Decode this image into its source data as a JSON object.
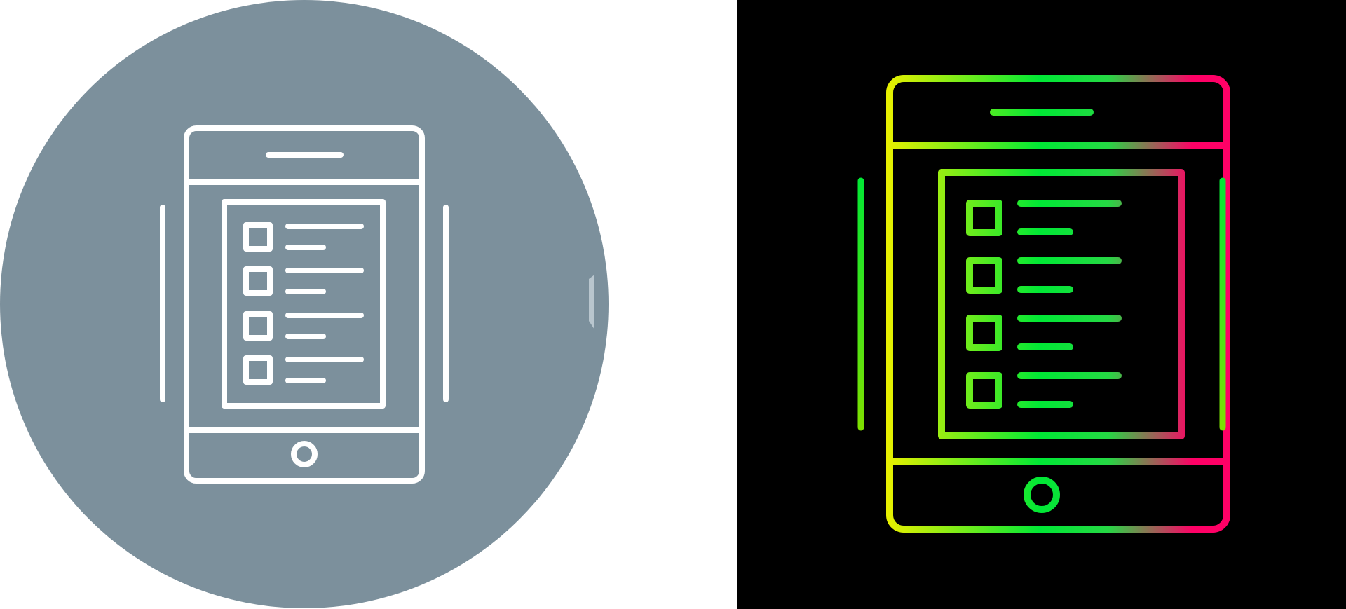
{
  "icons": [
    {
      "name": "checklist-tablet-icon",
      "variant": "light",
      "background": "#ffffff",
      "circle_color": "#7c909c",
      "stroke_color": "#ffffff"
    },
    {
      "name": "checklist-tablet-icon",
      "variant": "dark",
      "background": "#000000",
      "stroke_gradient": [
        "#e8f000",
        "#00e835",
        "#ff0066"
      ]
    }
  ],
  "checklist_item_count": 4
}
